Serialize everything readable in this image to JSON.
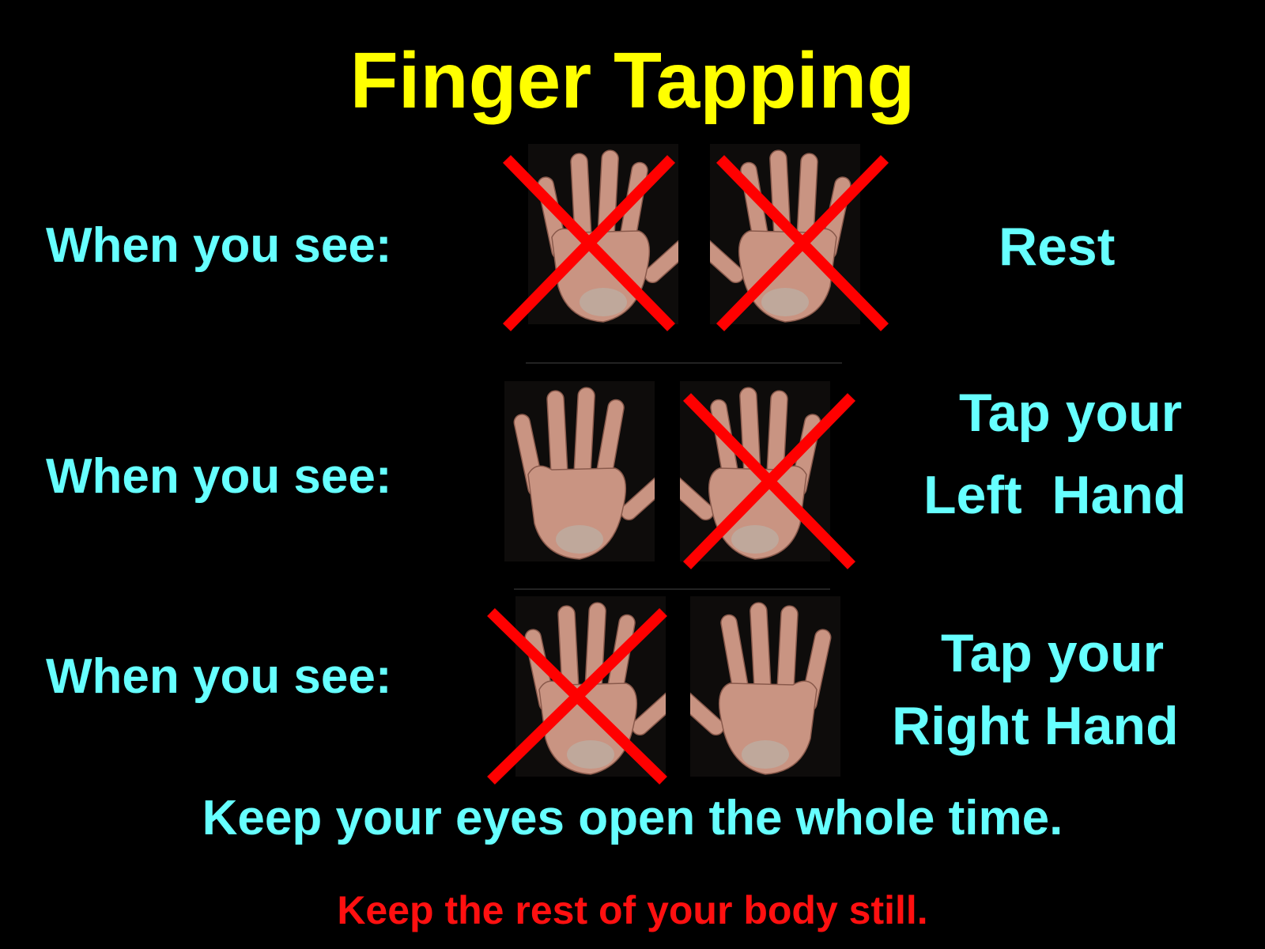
{
  "title": "Finger Tapping",
  "rows": [
    {
      "prompt": "When you see:",
      "instruction_line1": "Rest",
      "instruction_line2": "",
      "left_hand_crossed": true,
      "right_hand_crossed": true
    },
    {
      "prompt": "When you see:",
      "instruction_line1": "Tap your",
      "instruction_line2": "Left  Hand",
      "left_hand_crossed": false,
      "right_hand_crossed": true
    },
    {
      "prompt": "When you see:",
      "instruction_line1": "Tap your",
      "instruction_line2": "Right Hand",
      "left_hand_crossed": true,
      "right_hand_crossed": false
    }
  ],
  "footer_line1": "Keep your eyes open the whole time.",
  "footer_line2": "Keep the rest of your body still.",
  "colors": {
    "title": "#ffff00",
    "text": "#66ffff",
    "warning": "#ff1010",
    "cross": "#ff0000",
    "background": "#000000"
  }
}
